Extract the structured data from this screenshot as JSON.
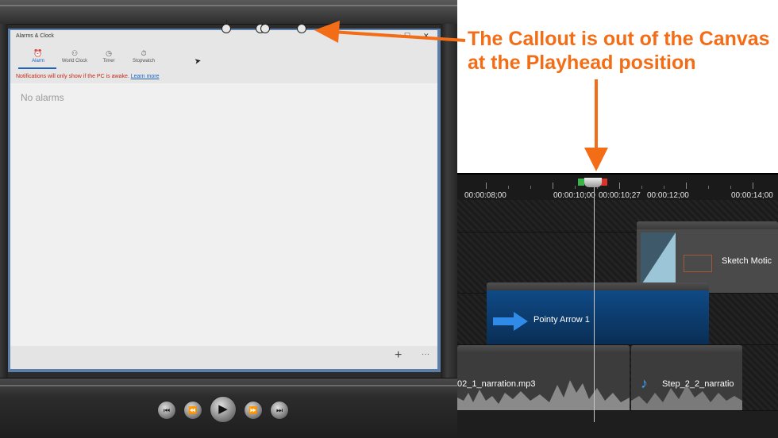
{
  "callout": {
    "line1": "The Callout is out of the Canvas",
    "line2": "at the Playhead position",
    "color": "#f26d16"
  },
  "app_window": {
    "title": "Alarms & Clock",
    "tabs": [
      {
        "label": "Alarm",
        "icon": "alarm-clock-icon",
        "active": true
      },
      {
        "label": "World Clock",
        "icon": "world-clock-icon",
        "active": false
      },
      {
        "label": "Timer",
        "icon": "timer-icon",
        "active": false
      },
      {
        "label": "Stopwatch",
        "icon": "stopwatch-icon",
        "active": false
      }
    ],
    "notice_text": "Notifications will only show if the PC is awake.",
    "notice_link": "Learn more",
    "empty_text": "No alarms",
    "add_symbol": "+",
    "more_symbol": "···",
    "accent": "#1e63c0"
  },
  "playback": {
    "buttons": [
      "previous",
      "rewind",
      "play",
      "fast-forward",
      "next"
    ]
  },
  "timeline": {
    "ruler": {
      "labels": [
        "00:00:08;00",
        "00:00:10;00",
        "00:00:10;27",
        "00:00:12;00",
        "00:00:14;00"
      ]
    },
    "playhead_time": "00:00:10;27",
    "clips": {
      "sketch": {
        "label": "Sketch Motic"
      },
      "arrow": {
        "label": "Pointy Arrow 1"
      },
      "audio1": {
        "label": "02_1_narration.mp3"
      },
      "audio2": {
        "label": "Step_2_2_narratio"
      }
    },
    "audio_icon": "music-note-icon"
  }
}
